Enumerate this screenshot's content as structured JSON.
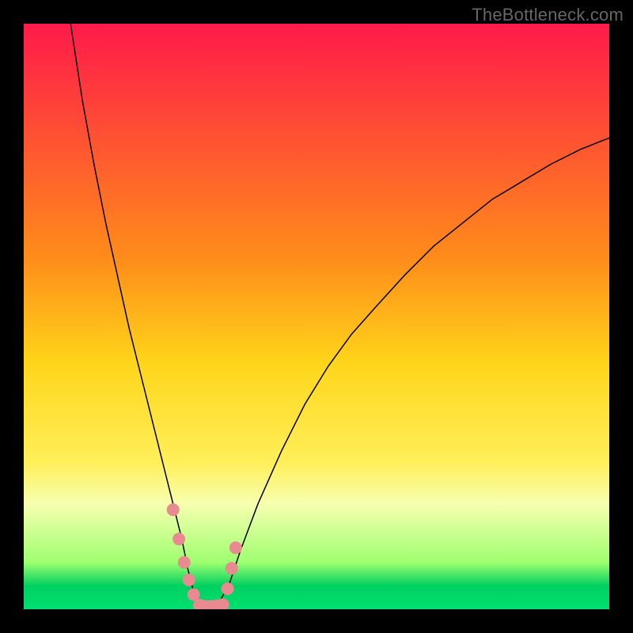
{
  "watermark": "TheBottleneck.com",
  "chart_data": {
    "type": "line",
    "title": "",
    "xlabel": "",
    "ylabel": "",
    "xlim": [
      0,
      100
    ],
    "ylim": [
      0,
      100
    ],
    "background": {
      "type": "vertical-gradient",
      "stops": [
        {
          "offset": 0,
          "color": "#ff1a4a"
        },
        {
          "offset": 40,
          "color": "#ff8c1a"
        },
        {
          "offset": 58,
          "color": "#ffd51a"
        },
        {
          "offset": 75,
          "color": "#ffef5a"
        },
        {
          "offset": 82,
          "color": "#f7ffb0"
        },
        {
          "offset": 92,
          "color": "#9eff70"
        },
        {
          "offset": 96,
          "color": "#00d060"
        },
        {
          "offset": 100,
          "color": "#00e070"
        }
      ]
    },
    "series": [
      {
        "name": "bottleneck-curve",
        "color": "#000000",
        "width": 1.5,
        "x": [
          8,
          10,
          12,
          14,
          16,
          18,
          20,
          22,
          24,
          25.5,
          27,
          28,
          29,
          30,
          31,
          33,
          35,
          37,
          40,
          44,
          48,
          52,
          56,
          60,
          65,
          70,
          75,
          80,
          85,
          90,
          95,
          100
        ],
        "y": [
          100,
          87,
          76,
          66,
          57,
          48,
          40,
          32,
          24,
          18,
          12,
          7,
          3,
          0.7,
          0.5,
          0.6,
          4,
          10,
          18,
          27,
          35,
          41.5,
          47,
          51.5,
          57,
          62,
          66,
          70,
          73,
          76,
          78.5,
          80.5
        ]
      },
      {
        "name": "data-points",
        "color": "#e88a90",
        "marker": "circle",
        "marker_size": 8,
        "x": [
          25.5,
          26.5,
          27.4,
          28.2,
          29,
          30,
          31,
          32,
          33,
          34,
          34.8,
          35.5,
          36.2
        ],
        "y": [
          17,
          12,
          8,
          5,
          2.5,
          0.7,
          0.5,
          0.5,
          0.6,
          0.8,
          3.5,
          7,
          10.5
        ]
      }
    ]
  }
}
